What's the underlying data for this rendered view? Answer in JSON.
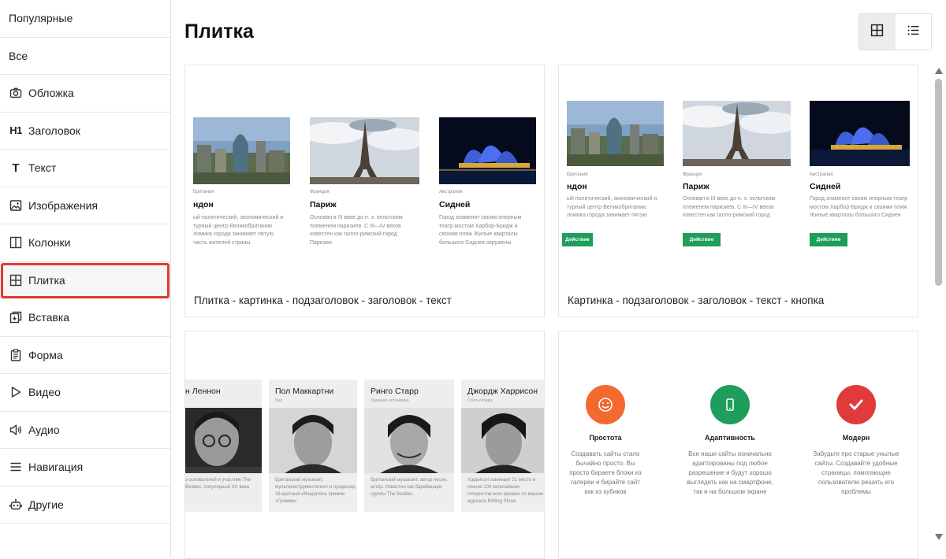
{
  "sidebar": {
    "items": [
      {
        "label": "Популярные",
        "icon": ""
      },
      {
        "label": "Все",
        "icon": ""
      },
      {
        "label": "Обложка",
        "icon": "camera-icon"
      },
      {
        "label": "Заголовок",
        "icon": "heading-h1-icon",
        "icon_text": "H1"
      },
      {
        "label": "Текст",
        "icon": "text-t-icon",
        "icon_text": "T"
      },
      {
        "label": "Изображения",
        "icon": "image-icon"
      },
      {
        "label": "Колонки",
        "icon": "columns-icon"
      },
      {
        "label": "Плитка",
        "icon": "grid-icon",
        "active": true
      },
      {
        "label": "Вставка",
        "icon": "embed-icon"
      },
      {
        "label": "Форма",
        "icon": "form-clipboard-icon"
      },
      {
        "label": "Видео",
        "icon": "play-icon"
      },
      {
        "label": "Аудио",
        "icon": "speaker-icon"
      },
      {
        "label": "Навигация",
        "icon": "menu-lines-icon"
      },
      {
        "label": "Другие",
        "icon": "robot-icon"
      }
    ],
    "active_outline_color": "#e03a32"
  },
  "main": {
    "title": "Плитка",
    "view_toggle": {
      "grid_icon": "grid-view-icon",
      "list_icon": "list-view-icon",
      "selected": "grid"
    },
    "cards": [
      {
        "caption": "Плитка - картинка - подзаголовок - заголовок - текст",
        "tiles": [
          {
            "country": "Британия",
            "city": "ндон",
            "desc": "ый политический, экономический и турный центр Великобритании. ломика города занимает пятую часть жителей страны."
          },
          {
            "country": "Франция",
            "city": "Париж",
            "desc": "Основан в III веке до н. э. кельтским племенем паризиев. С III—IV веков известен как галло-римский город Паризии."
          },
          {
            "country": "Австралия",
            "city": "Сидней",
            "desc": "Город знаменит своим оперным театр мостом Харбор-Бридж и своими пляж Жилые кварталы большого Сиднея окружены национальными парками."
          }
        ]
      },
      {
        "caption": "Картинка - подзаголовок - заголовок - текст - кнопка",
        "button_label": "Действие",
        "tiles": [
          {
            "country": "Британия",
            "city": "ндон",
            "desc": "ый политический, экономический и турный центр Великобритании. ломика города занимает пятую часть жителей страны."
          },
          {
            "country": "Франция",
            "city": "Париж",
            "desc": "Основан в III веке до н. э. кельтским племенем паризиев. С III—IV веков известен как галло-римский город Паризии."
          },
          {
            "country": "Австралия",
            "city": "Сидней",
            "desc": "Город знаменит своим оперным театр мостом Харбор-Бридж и своими пляж Жилые кварталы большого Сиднея окружены национальными парками."
          }
        ]
      },
      {
        "people": [
          {
            "name": "н Леннон",
            "role": "",
            "desc": "з основателей и участник The Beatles, популярный XX века"
          },
          {
            "name": "Пол Маккартни",
            "role": "Бас",
            "desc": "Британский музыкант, мультиинструменталист и продюсер, 16-кратный обладатель премии «Грэмми»"
          },
          {
            "name": "Ринго Старр",
            "role": "Ударная установка",
            "desc": "британский музыкант, автор песен, актёр. Известен как барабанщик группы The Beatles."
          },
          {
            "name": "Джордж Харрисон",
            "role": "Соло-гитара",
            "desc": "Харрисон занимает 21 место в списке 100 величайших гитаристов всех времен по версии журнала Rolling Stone."
          }
        ]
      },
      {
        "features": [
          {
            "title": "Простота",
            "icon": "smile-icon",
            "color": "#f26a2e",
            "desc": "Создавать сайты стало бычайно просто. Вы просто бираете блоки из галереи и бирайте сайт как из кубиков"
          },
          {
            "title": "Адаптивность",
            "icon": "phone-icon",
            "color": "#1e9d5d",
            "desc": "Все наши сайты изначально адаптированы под любое разрешение и будут хорошо выглядеть как на смартфоне, так и на большом экране"
          },
          {
            "title": "Модерн",
            "icon": "check-icon",
            "color": "#e03a3a",
            "desc": "Забудьте про старые унылые сайты. Создавайте удобные страницы, помогающие пользователю решить его проблемы"
          }
        ]
      }
    ]
  }
}
